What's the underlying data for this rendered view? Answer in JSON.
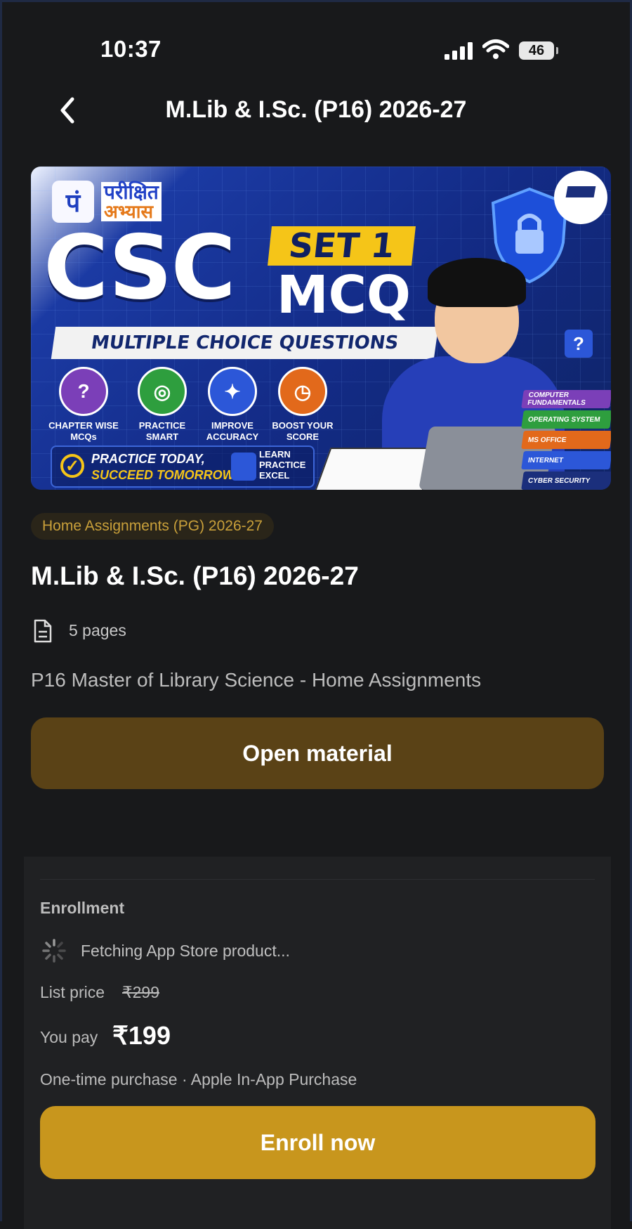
{
  "status_bar": {
    "time": "10:37",
    "battery": "46"
  },
  "nav": {
    "title": "M.Lib & I.Sc. (P16) 2026-27"
  },
  "banner": {
    "logo_mark": "पं",
    "logo_line1": "परीक्षित",
    "logo_line2": "अभ्यास",
    "headline": "CSC",
    "set_label": "SET 1",
    "mcq_label": "MCQ",
    "ribbon": "MULTIPLE CHOICE QUESTIONS",
    "features": [
      {
        "label": "CHAPTER WISE MCQs",
        "color": "#7b3fb8",
        "symbol": "?"
      },
      {
        "label": "PRACTICE SMART",
        "color": "#2e9e3e",
        "symbol": "◎"
      },
      {
        "label": "IMPROVE ACCURACY",
        "color": "#2c57d8",
        "symbol": "✦"
      },
      {
        "label": "BOOST YOUR SCORE",
        "color": "#e2691b",
        "symbol": "◷"
      }
    ],
    "cta_line1": "PRACTICE TODAY,",
    "cta_line2": "SUCCEED TOMORROW!",
    "cta_side": "LEARN PRACTICE EXCEL",
    "qmark": "?",
    "books": [
      {
        "label": "COMPUTER FUNDAMENTALS",
        "color": "#7b3fb8"
      },
      {
        "label": "OPERATING SYSTEM",
        "color": "#2e9e3e"
      },
      {
        "label": "MS OFFICE",
        "color": "#e2691b"
      },
      {
        "label": "INTERNET",
        "color": "#2c57d8"
      },
      {
        "label": "CYBER SECURITY",
        "color": "#1b2f7c"
      }
    ]
  },
  "material": {
    "tag": "Home Assignments (PG) 2026-27",
    "title": "M.Lib & I.Sc. (P16) 2026-27",
    "pages": "5 pages",
    "description": "P16 Master of Library Science - Home Assignments",
    "open_button": "Open material"
  },
  "enrollment": {
    "heading": "Enrollment",
    "fetching": "Fetching App Store product...",
    "list_price_label": "List price",
    "list_price": "₹299",
    "you_pay_label": "You pay",
    "you_pay": "₹199",
    "purchase_note": "One-time purchase · Apple In-App Purchase",
    "enroll_button": "Enroll now"
  },
  "colors": {
    "accent": "#c8961d",
    "open_button": "#5a4216",
    "tag_text": "#c9a03a"
  }
}
